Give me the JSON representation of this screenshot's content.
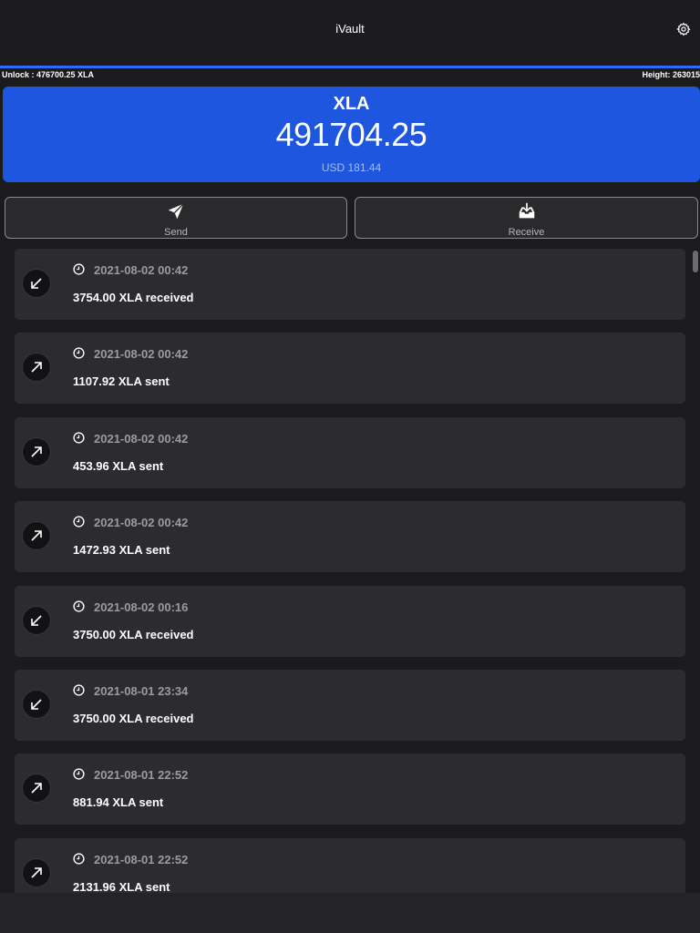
{
  "window": {
    "title": "iVault",
    "settings_icon": "gear-icon"
  },
  "sync": {
    "progress": 1.0,
    "unlock_text": "Unlock : 476700.25 XLA",
    "height_text": "Height: 263015"
  },
  "balance": {
    "ticker": "XLA",
    "amount": "491704.25",
    "fiat": "USD 181.44",
    "card_color": "#1e56e0"
  },
  "actions": {
    "send": {
      "label": "Send",
      "icon": "paper-plane-icon"
    },
    "receive": {
      "label": "Receive",
      "icon": "inbox-download-icon"
    }
  },
  "transactions": [
    {
      "direction": "received",
      "date": "2021-08-02 00:42",
      "text": "3754.00 XLA received"
    },
    {
      "direction": "sent",
      "date": "2021-08-02 00:42",
      "text": "1107.92 XLA sent"
    },
    {
      "direction": "sent",
      "date": "2021-08-02 00:42",
      "text": "453.96 XLA sent"
    },
    {
      "direction": "sent",
      "date": "2021-08-02 00:42",
      "text": "1472.93 XLA sent"
    },
    {
      "direction": "received",
      "date": "2021-08-02 00:16",
      "text": "3750.00 XLA received"
    },
    {
      "direction": "received",
      "date": "2021-08-01 23:34",
      "text": "3750.00 XLA received"
    },
    {
      "direction": "sent",
      "date": "2021-08-01 22:52",
      "text": "881.94 XLA sent"
    },
    {
      "direction": "sent",
      "date": "2021-08-01 22:52",
      "text": "2131.96 XLA sent"
    }
  ]
}
